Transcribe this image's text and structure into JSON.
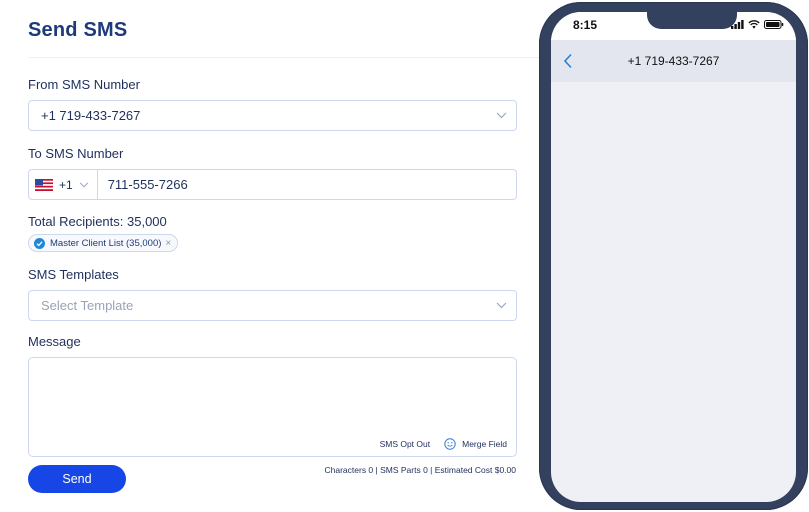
{
  "page": {
    "title": "Send SMS"
  },
  "from": {
    "label": "From SMS Number",
    "value": "+1 719-433-7267"
  },
  "to": {
    "label": "To SMS Number",
    "dial_code": "+1",
    "country_flag": "us-flag-icon",
    "value": "711-555-7266"
  },
  "recipients": {
    "label": "Total Recipients: 35,000",
    "chip_label": "Master Client List (35,000)",
    "chip_remove": "×"
  },
  "templates": {
    "label": "SMS Templates",
    "placeholder": "Select Template"
  },
  "message": {
    "label": "Message",
    "opt_out_label": "SMS Opt Out",
    "merge_field_label": "Merge Field"
  },
  "counter": {
    "text": "Characters 0 | SMS Parts 0 | Estimated Cost $0.00"
  },
  "send": {
    "label": "Send"
  },
  "phone_preview": {
    "time": "8:15",
    "contact_number": "+1 719-433-7267"
  },
  "colors": {
    "brand_blue": "#1746e6",
    "title_blue": "#1e3a7a",
    "border": "#cdd8ee",
    "phone_frame": "#33415f",
    "check_blue": "#1e88d6"
  }
}
